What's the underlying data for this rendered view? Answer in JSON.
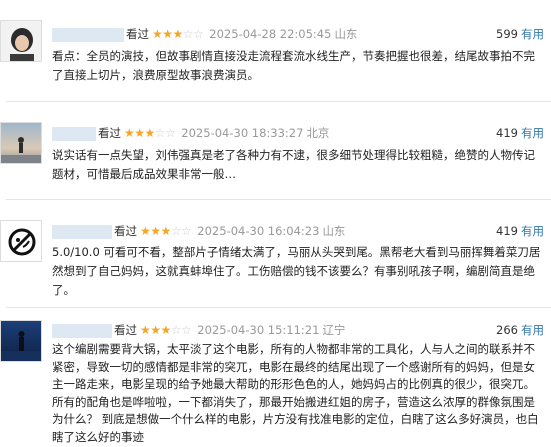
{
  "reviews": [
    {
      "watched": "看过",
      "stars": "★★★",
      "stars_off": "☆☆",
      "time": "2025-04-28 22:05:45",
      "location": "山东",
      "votes": "599",
      "useful_label": "有用",
      "content": "看点：全员的演技，但故事剧情直接没走流程套流水线生产，节奏把握也很差，结尾故事拍不完了直接上切片，浪费原型故事浪费演员。"
    },
    {
      "watched": "看过",
      "stars": "★★★",
      "stars_off": "☆☆",
      "time": "2025-04-30 18:33:27",
      "location": "北京",
      "votes": "419",
      "useful_label": "有用",
      "content": "说实话有一点失望，刘伟强真是老了各种力有不逮，很多细节处理得比较粗糙，绝赞的人物传记题材，可惜最后成品效果非常一般…"
    },
    {
      "watched": "看过",
      "stars": "★★★",
      "stars_off": "☆☆",
      "time": "2025-04-30 16:04:23",
      "location": "山东",
      "votes": "419",
      "useful_label": "有用",
      "content": "5.0/10.0 可看可不看，整部片子情绪太满了，马丽从头哭到尾。黑帮老大看到马丽挥舞着菜刀居然想到了自己妈妈，这就真蚌埠住了。工伤赔偿的钱不该要么？有事别吼孩子啊，编剧简直是绝了。"
    },
    {
      "watched": "看过",
      "stars": "★★★",
      "stars_off": "☆☆",
      "time": "2025-04-30 15:11:21",
      "location": "辽宁",
      "votes": "266",
      "useful_label": "有用",
      "content": "这个编剧需要背大锅，太平淡了这个电影，所有的人物都非常的工具化，人与人之间的联系并不紧密，导致一切的感情都是非常的突兀，电影在最终的结尾出现了一个感谢所有的妈妈，但是女主一路走来，电影呈现的给予她最大帮助的形形色色的人，她妈妈占的比例真的很少，很突兀。 所有的配角也是哗啦啦，一下都消失了，那最开始搬进红姐的房子，营造这么浓厚的群像氛围是为什么？ 到底是想做一个什么样的电影，片方没有找准电影的定位，白瞎了这么多好演员，也白瞎了这么好的事迹"
    }
  ]
}
